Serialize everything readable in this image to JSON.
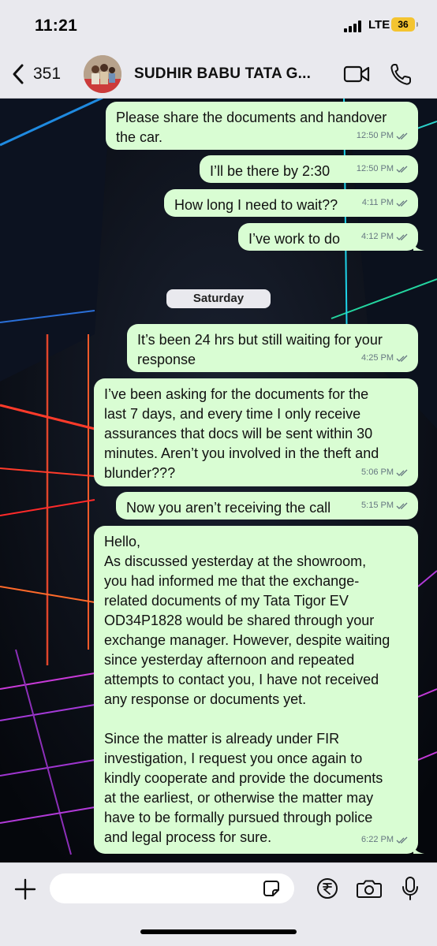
{
  "status_bar": {
    "time": "11:21",
    "network": "LTE",
    "battery": "36"
  },
  "header": {
    "back_count": "351",
    "contact_name": "SUDHIR BABU TATA G...",
    "icons": {
      "back": "chevron-left-icon",
      "video": "video-camera-icon",
      "call": "phone-icon"
    }
  },
  "date_separator": "Saturday",
  "messages": [
    {
      "text": "Please share the documents and handover\nthe car.",
      "time": "12:50 PM"
    },
    {
      "text": "I’ll be there by 2:30",
      "time": "12:50 PM"
    },
    {
      "text": "How long I need to wait??",
      "time": "4:11 PM"
    },
    {
      "text": "I’ve work to do",
      "time": "4:12 PM"
    },
    {
      "text": "It’s been 24 hrs but still waiting for your\nresponse",
      "time": "4:25 PM"
    },
    {
      "text": "I’ve been asking for the documents for the\nlast 7 days, and every time I only receive\nassurances that docs will be sent within 30\nminutes. Aren’t you involved in the theft and\nblunder???",
      "time": "5:06 PM"
    },
    {
      "text": "Now you aren’t receiving the call",
      "time": "5:15 PM"
    },
    {
      "text": "Hello,\nAs discussed yesterday at the showroom,\nyou had informed me that the exchange-\nrelated documents of my Tata Tigor EV\nOD34P1828 would be shared through your\nexchange manager. However, despite waiting\nsince yesterday afternoon and repeated\nattempts to contact you, I have not received\nany response or documents yet.\n\nSince the matter is already under FIR\ninvestigation, I request you once again to\nkindly cooperate and provide the documents\nat the earliest, or otherwise the matter may\nhave to be formally pursued through police\nand legal process for sure.",
      "time": "6:22 PM"
    }
  ],
  "composer": {
    "input_value": "",
    "icons": {
      "plus": "plus-icon",
      "sticker": "sticker-icon",
      "payment": "rupee-icon",
      "camera": "camera-icon",
      "mic": "microphone-icon"
    }
  },
  "colors": {
    "bubble": "#d9fdd3",
    "bar_background": "#e9e9ee",
    "timestamp": "#667781",
    "battery": "#f4c430"
  }
}
